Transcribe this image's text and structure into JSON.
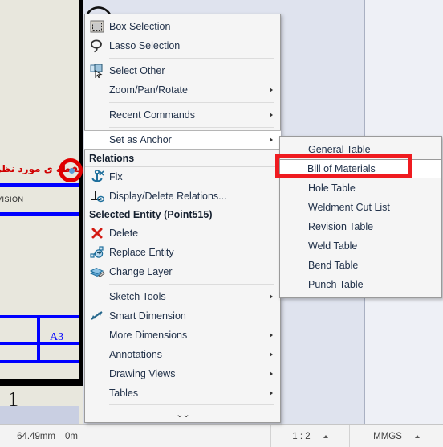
{
  "app": {
    "kind": "cad-drawing-context-menu"
  },
  "drawing": {
    "annotation_note": "نقطه ی مورد نظر",
    "annotation_color": "#d00000",
    "revision_label": "VISION",
    "sheet_size_label": "A3",
    "zone_label": "1",
    "point_marker_color": "#5b9bd5",
    "line_color": "#0000ff"
  },
  "context_menu": {
    "items": [
      {
        "label": "Box Selection",
        "icon": "box-selection-icon",
        "arrow": false,
        "highlighted": false
      },
      {
        "label": "Lasso Selection",
        "icon": "lasso-selection-icon",
        "arrow": false,
        "highlighted": false
      },
      {
        "label": "Select Other",
        "icon": "select-other-icon",
        "arrow": false,
        "highlighted": false
      },
      {
        "label": "Zoom/Pan/Rotate",
        "icon": "none",
        "arrow": true,
        "highlighted": false
      },
      {
        "label": "Recent Commands",
        "icon": "none",
        "arrow": true,
        "highlighted": false
      },
      {
        "label": "Set as Anchor",
        "icon": "none",
        "arrow": true,
        "highlighted": true
      }
    ],
    "relations_header": "Relations",
    "relations_items": [
      {
        "label": "Fix",
        "icon": "anchor-fix-icon"
      },
      {
        "label": "Display/Delete Relations...",
        "icon": "display-delete-relations-icon"
      }
    ],
    "selected_entity_header": "Selected Entity (Point515)",
    "entity_items": [
      {
        "label": "Delete",
        "icon": "delete-x-icon"
      },
      {
        "label": "Replace Entity",
        "icon": "replace-entity-icon"
      },
      {
        "label": "Change Layer",
        "icon": "change-layer-icon"
      }
    ],
    "tool_items": [
      {
        "label": "Sketch Tools",
        "icon": "none",
        "arrow": true
      },
      {
        "label": "Smart Dimension",
        "icon": "smart-dimension-icon",
        "arrow": false
      },
      {
        "label": "More Dimensions",
        "icon": "none",
        "arrow": true
      },
      {
        "label": "Annotations",
        "icon": "none",
        "arrow": true
      },
      {
        "label": "Drawing Views",
        "icon": "none",
        "arrow": true
      },
      {
        "label": "Tables",
        "icon": "none",
        "arrow": true
      }
    ],
    "expand_chevron": "⌄⌄"
  },
  "tables_submenu": {
    "items": [
      {
        "label": "General Table",
        "highlighted": false
      },
      {
        "label": "Bill of Materials",
        "highlighted": true
      },
      {
        "label": "Hole Table",
        "highlighted": false
      },
      {
        "label": "Weldment Cut List",
        "highlighted": false
      },
      {
        "label": "Revision Table",
        "highlighted": false
      },
      {
        "label": "Weld Table",
        "highlighted": false
      },
      {
        "label": "Bend Table",
        "highlighted": false
      },
      {
        "label": "Punch Table",
        "highlighted": false
      }
    ],
    "highlight_box_color": "#ef1b20"
  },
  "status_bar": {
    "coordinate_x": "64.49mm",
    "coordinate_y": "0m",
    "scale": "1 : 2",
    "units": "MMGS"
  }
}
